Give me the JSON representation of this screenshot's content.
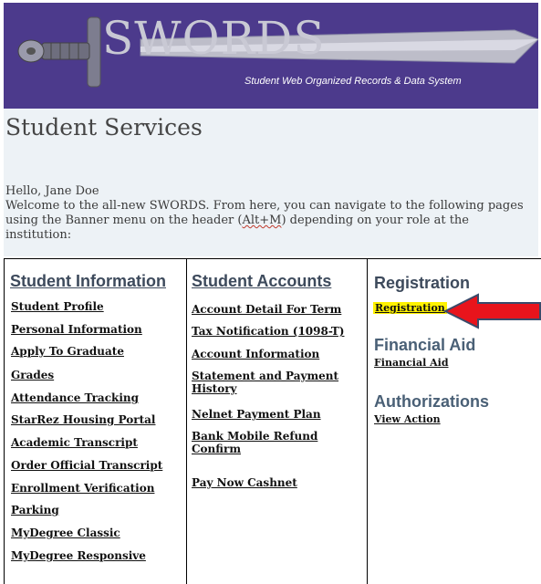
{
  "banner": {
    "logo_text": "SWORDS",
    "subtitle": "Student Web Organized Records & Data System"
  },
  "page": {
    "title": "Student Services",
    "greeting": "Hello, Jane Doe",
    "welcome_pre": "Welcome to the all-new SWORDS. From here, you can navigate to the following pages using the Banner menu on the header (",
    "welcome_key": "Alt+M",
    "welcome_post": ") depending on your role at the institution:"
  },
  "student_information": {
    "heading": "Student Information",
    "links": [
      "Student Profile",
      "Personal Information",
      "Apply To Graduate",
      "Grades",
      "Attendance Tracking",
      "StarRez Housing Portal",
      "Academic Transcript",
      "Order Official Transcript",
      "Enrollment Verification",
      "Parking",
      "MyDegree Classic",
      "MyDegree Responsive"
    ]
  },
  "student_accounts": {
    "heading": "Student Accounts",
    "links": [
      "Account Detail For Term",
      "Tax Notification (1098-T)",
      "Account Information",
      "Statement and Payment History",
      "Nelnet Payment Plan",
      "Bank Mobile Refund Confirm",
      "Pay Now Cashnet"
    ]
  },
  "registration": {
    "heading": "Registration",
    "link": "Registration"
  },
  "financial_aid": {
    "heading": "Financial Aid",
    "link": "Financial Aid"
  },
  "authorizations": {
    "heading": "Authorizations",
    "link": "View Action"
  },
  "colors": {
    "banner_bg": "#4c3a8c",
    "header_bg": "#edf2f6",
    "highlight": "#fff200",
    "arrow": "#e8141c"
  }
}
